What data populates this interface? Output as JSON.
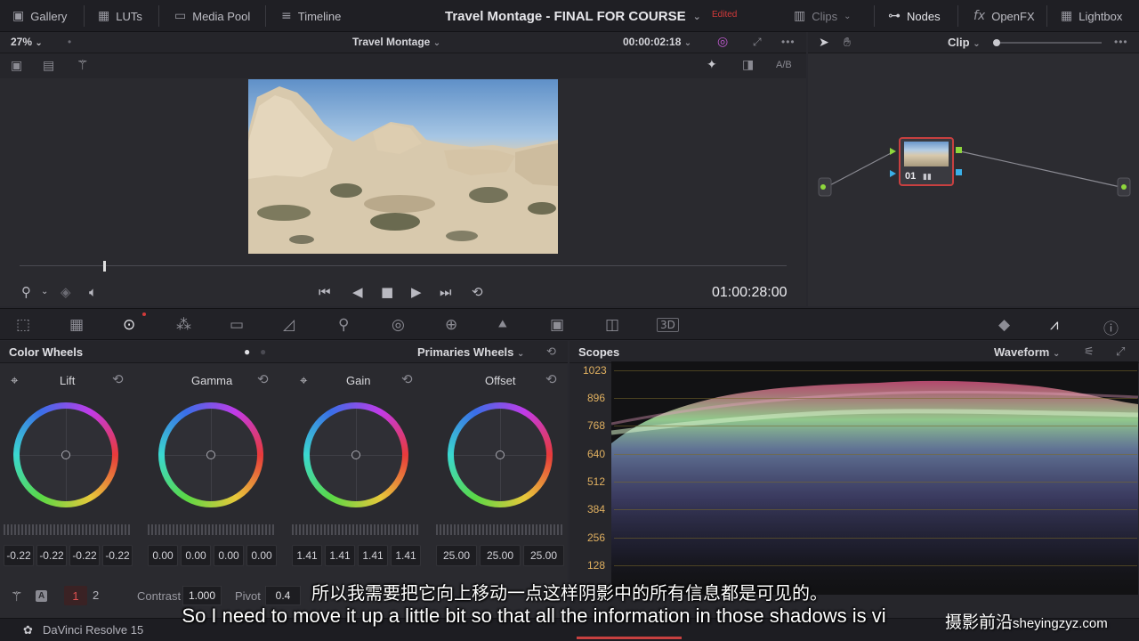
{
  "topbar": {
    "gallery": "Gallery",
    "luts": "LUTs",
    "media_pool": "Media Pool",
    "timeline": "Timeline",
    "project_title": "Travel Montage - FINAL FOR COURSE",
    "edited_badge": "Edited",
    "clips": "Clips",
    "nodes": "Nodes",
    "openfx": "OpenFX",
    "lightbox": "Lightbox"
  },
  "viewer": {
    "zoom": "27%",
    "timeline_name": "Travel Montage",
    "duration": "00:00:02:18",
    "ab_label": "A/B",
    "timecode": "01:00:28:00"
  },
  "nodes": {
    "mode": "Clip",
    "node_label": "01"
  },
  "color_wheels": {
    "title": "Color Wheels",
    "mode": "Primaries Wheels",
    "wheels": [
      {
        "name": "Lift",
        "values": [
          "-0.22",
          "-0.22",
          "-0.22",
          "-0.22"
        ]
      },
      {
        "name": "Gamma",
        "values": [
          "0.00",
          "0.00",
          "0.00",
          "0.00"
        ]
      },
      {
        "name": "Gain",
        "values": [
          "1.41",
          "1.41",
          "1.41",
          "1.41"
        ]
      },
      {
        "name": "Offset",
        "values": [
          "25.00",
          "25.00",
          "25.00"
        ]
      }
    ],
    "page_1": "1",
    "page_2": "2",
    "contrast_label": "Contrast",
    "contrast_value": "1.000",
    "pivot_label": "Pivot",
    "pivot_value": "0.4"
  },
  "scopes": {
    "title": "Scopes",
    "mode": "Waveform",
    "ticks": [
      "1023",
      "896",
      "768",
      "640",
      "512",
      "384",
      "256",
      "128"
    ]
  },
  "status": {
    "app_name": "DaVinci Resolve 15"
  },
  "subtitles": {
    "zh": "所以我需要把它向上移动一点这样阴影中的所有信息都是可见的。",
    "en": "So I need to move it up a little bit so that all the information in those shadows is vi"
  },
  "watermark": {
    "cn": "摄影前沿",
    "url": "sheyingzyz.com"
  },
  "colors": {
    "accent_red": "#d23a3a",
    "node_border": "#c84040",
    "scope_grid": "#7a6a2a",
    "scope_label": "#e0b060"
  }
}
